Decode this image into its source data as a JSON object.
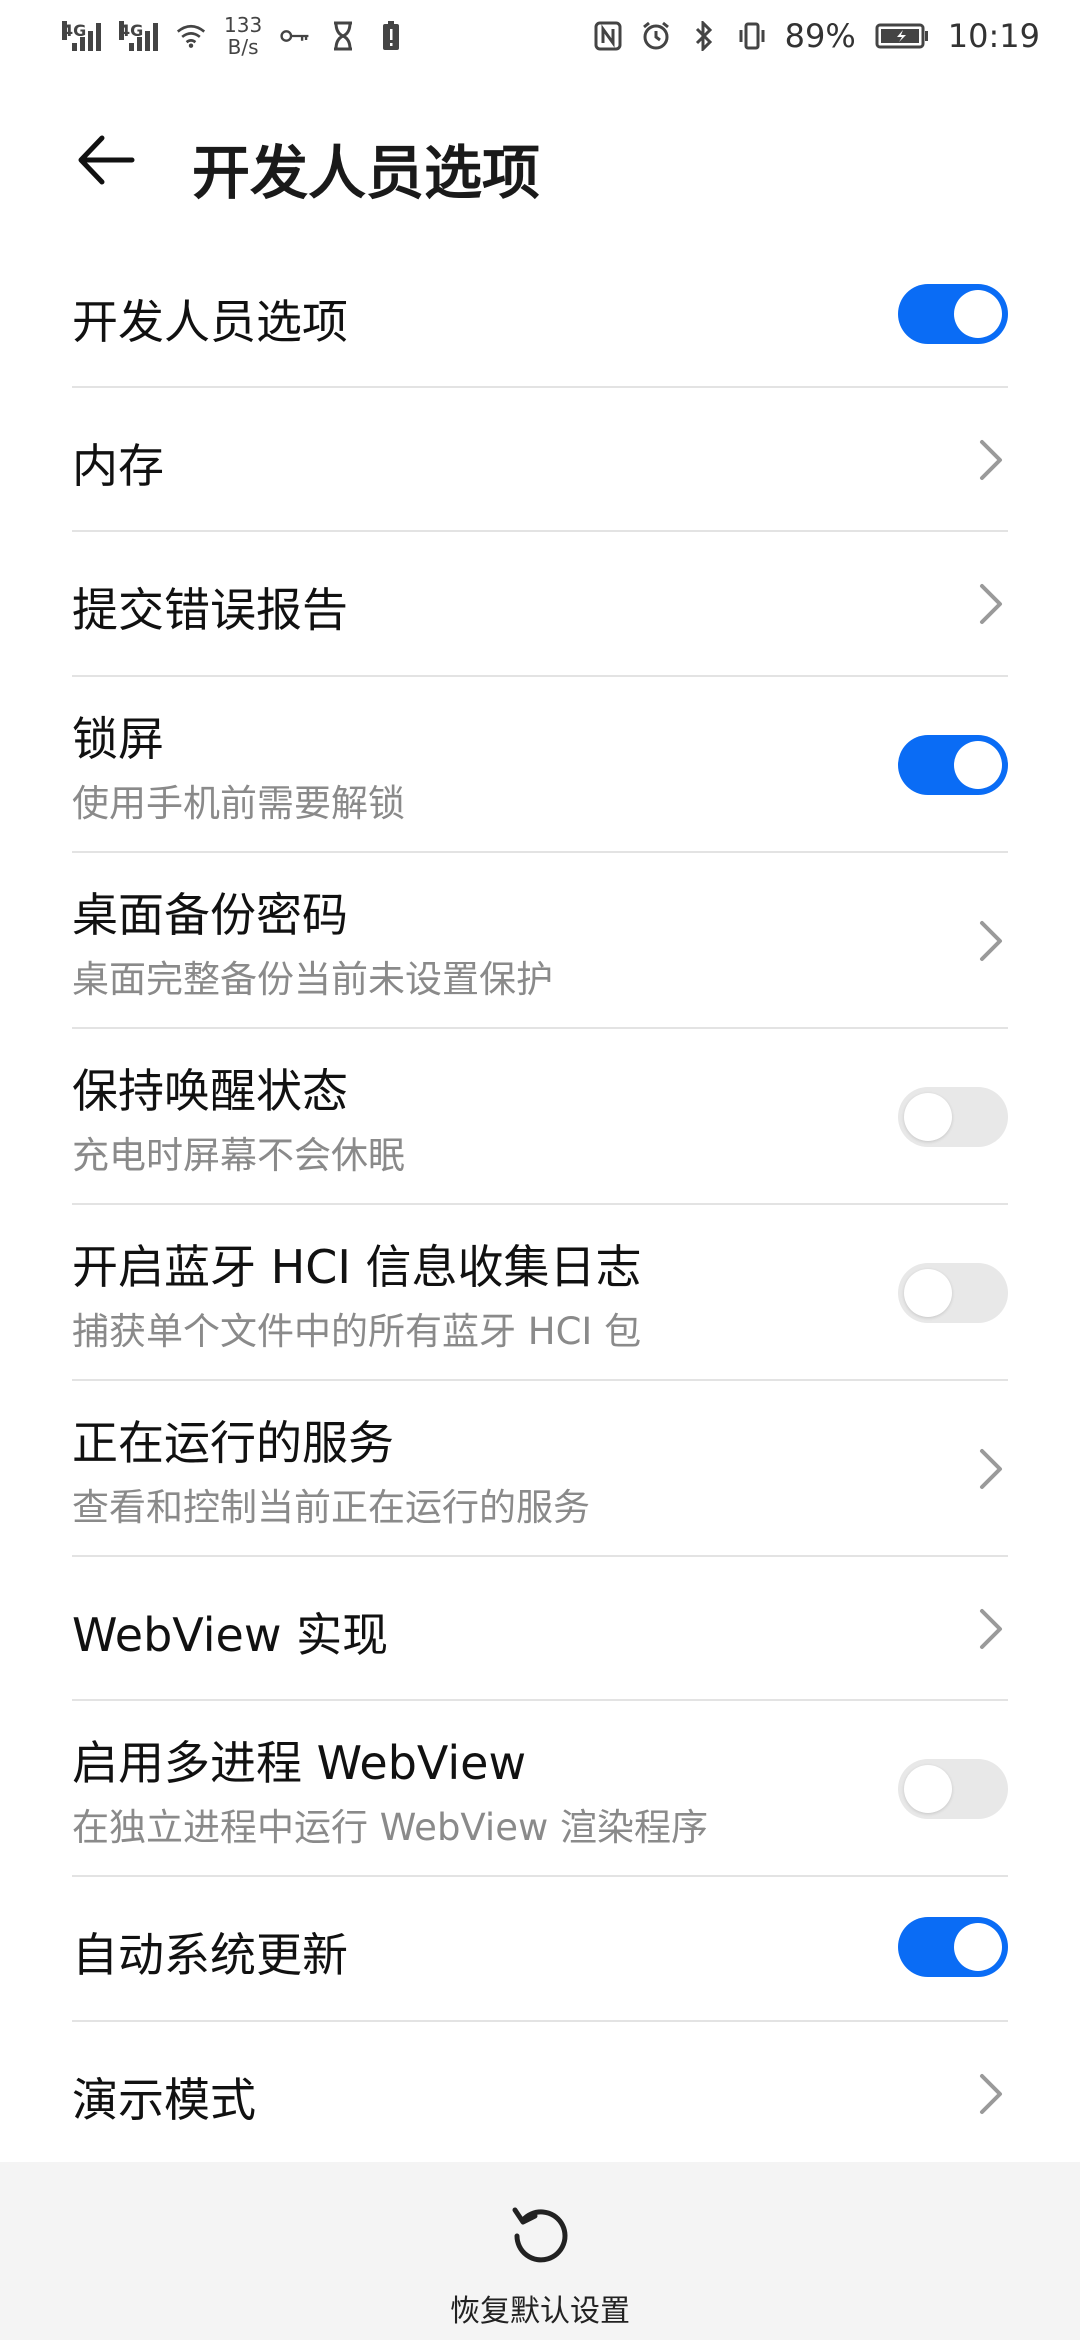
{
  "status_bar": {
    "sim1": "4G",
    "sim2": "4G",
    "speed_value": "133",
    "speed_unit": "B/s",
    "battery_percent": "89%",
    "time": "10:19"
  },
  "header": {
    "title": "开发人员选项"
  },
  "rows": [
    {
      "label": "开发人员选项",
      "control": "toggle",
      "state": "on"
    },
    {
      "label": "内存",
      "control": "chevron"
    },
    {
      "label": "提交错误报告",
      "control": "chevron"
    },
    {
      "label": "锁屏",
      "sub": "使用手机前需要解锁",
      "control": "toggle",
      "state": "on"
    },
    {
      "label": "桌面备份密码",
      "sub": "桌面完整备份当前未设置保护",
      "control": "chevron"
    },
    {
      "label": "保持唤醒状态",
      "sub": "充电时屏幕不会休眠",
      "control": "toggle",
      "state": "off"
    },
    {
      "label": "开启蓝牙 HCI 信息收集日志",
      "sub": "捕获单个文件中的所有蓝牙 HCI 包",
      "control": "toggle",
      "state": "off"
    },
    {
      "label": "正在运行的服务",
      "sub": "查看和控制当前正在运行的服务",
      "control": "chevron"
    },
    {
      "label": "WebView 实现",
      "control": "chevron"
    },
    {
      "label": "启用多进程 WebView",
      "sub": "在独立进程中运行 WebView 渲染程序",
      "control": "toggle",
      "state": "off"
    },
    {
      "label": "自动系统更新",
      "control": "toggle",
      "state": "on"
    },
    {
      "label": "演示模式",
      "control": "chevron"
    }
  ],
  "bottom": {
    "reset_label": "恢复默认设置"
  },
  "colors": {
    "accent": "#0a6cf5",
    "toggle_off": "#e8e8e8",
    "divider": "#e3e3e3",
    "subtext": "#8a8a8a",
    "bottom_bg": "#f4f4f4"
  }
}
